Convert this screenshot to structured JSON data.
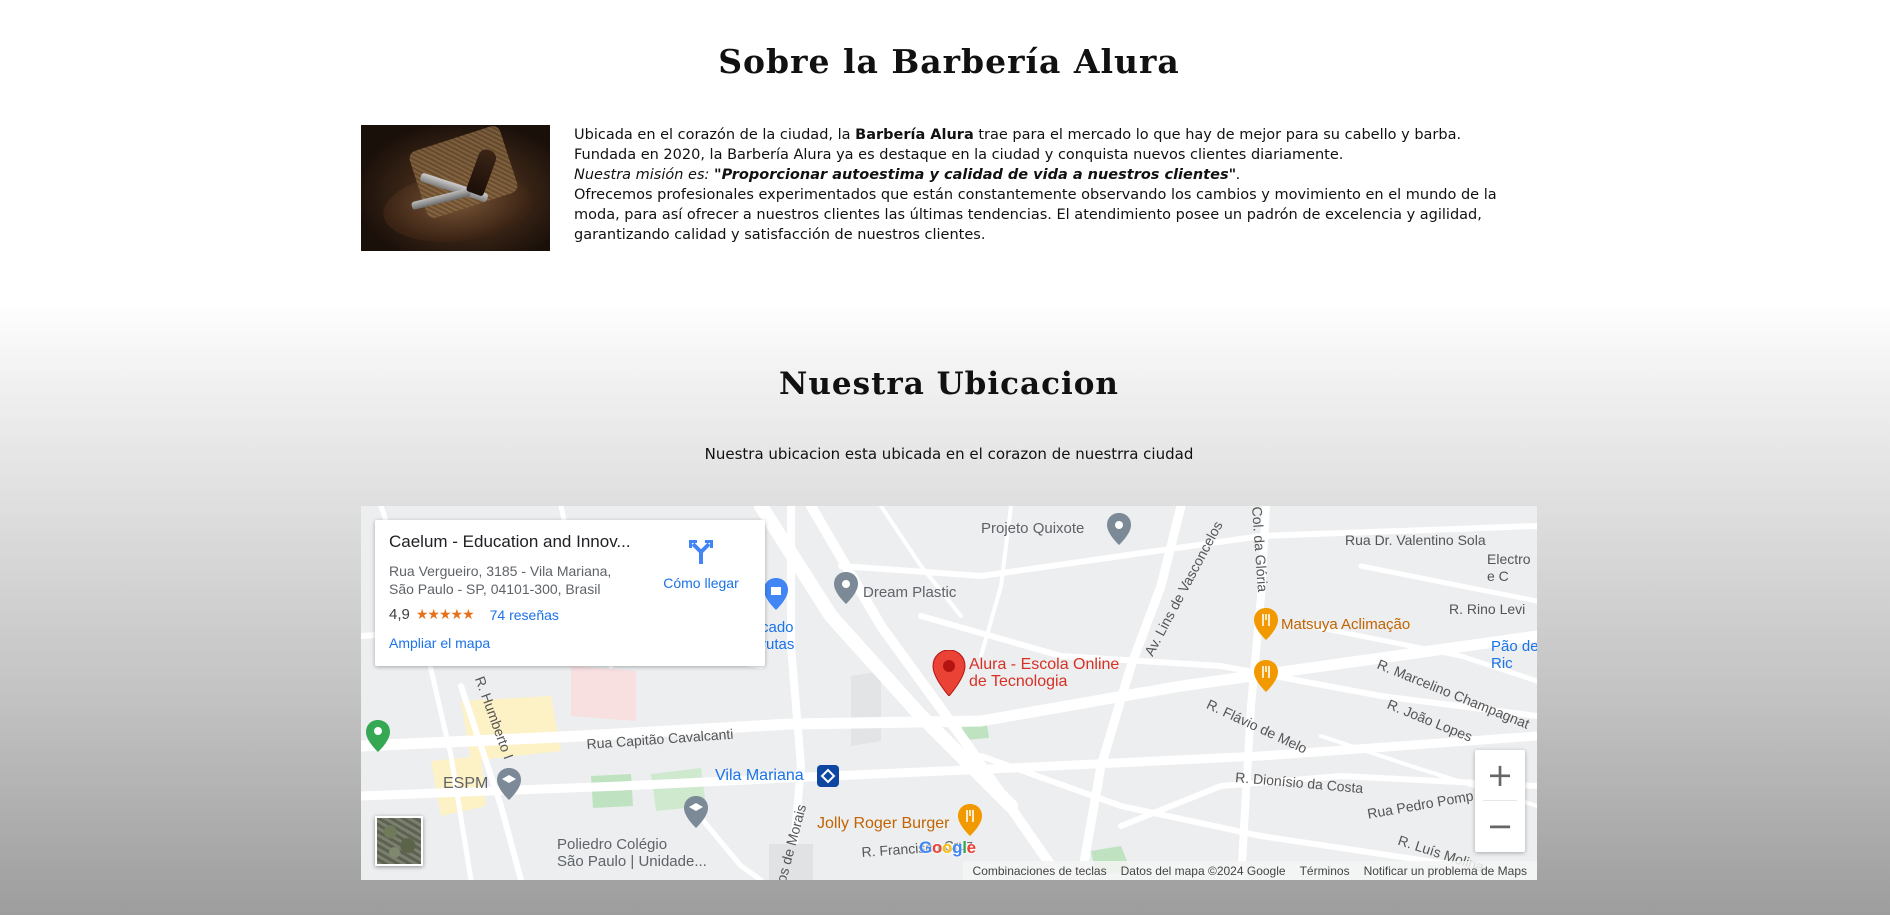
{
  "about": {
    "title": "Sobre la Barbería Alura",
    "p1_pre": "Ubicada en el corazón de la ciudad, la ",
    "p1_brand": "Barbería Alura",
    "p1_post": " trae para el mercado lo que hay de mejor para su cabello y barba.",
    "p2": "Fundada en 2020, la Barbería Alura ya es destaque en la ciudad y conquista nuevos clientes diariamente.",
    "mission_pre": "Nuestra misión es: ",
    "mission_quote": "\"Proporcionar autoestima y calidad de vida a nuestros clientes\"",
    "mission_end": ".",
    "p4": "Ofrecemos profesionales experimentados que están constantemente observando los cambios y movimiento en el mundo de la moda, para así ofrecer a nuestros clientes las últimas tendencias. El atendimiento posee un padrón de excelencia y agilidad, garantizando calidad y satisfacción de nuestros clientes."
  },
  "location": {
    "title": "Nuestra Ubicacion",
    "subtitle": "Nuestra ubicacion esta ubicada en el corazon de nuestrra ciudad"
  },
  "map": {
    "card": {
      "title": "Caelum - Education and Innov...",
      "address_line1": "Rua Vergueiro, 3185 - Vila Mariana,",
      "address_line2": "São Paulo - SP, 04101-300, Brasil",
      "rating": "4,9",
      "stars": "★★★★★",
      "reviews": "74 reseñas",
      "enlarge": "Ampliar el mapa",
      "directions": "Cómo llegar"
    },
    "labels": {
      "projeto_quixote": "Projeto Quixote",
      "dream_plastic": "Dream Plastic",
      "alura_line1": "Alura - Escola Online",
      "alura_line2": "de Tecnologia",
      "matsuya": "Matsuya Aclimação",
      "vila_mariana": "Vila Mariana",
      "espm": "ESPM",
      "jolly": "Jolly Roger Burger",
      "poliedro_line1": "Poliedro Colégio",
      "poliedro_line2": "São Paulo | Unidade...",
      "mercado_line1": "cado",
      "mercado_line2": "rutas",
      "pao_line1": "Pão de",
      "pao_line2": "Ric"
    },
    "streets": {
      "valentino": "Rua Dr. Valentino Sola",
      "electro_line1": "Electro",
      "electro_line2": "e C",
      "rino_levi": "R. Rino Levi",
      "marcelino": "R. Marcelino Champagnat",
      "joao_lopes": "R. João Lopes",
      "flavio": "R. Flávio de Melo",
      "dionisio": "R. Dionísio da Costa",
      "pedro": "Rua Pedro Pomp",
      "luis": "R. Luís Molina",
      "capitao": "Rua Capitão Cavalcanti",
      "humberto": "R. Humberto I",
      "lins": "Av. Lins de Vasconcelos",
      "gloria": "Col. da Glória",
      "francisco": "R. Francisco Cruz",
      "morais": "os de Morais"
    },
    "zoom_in": "+",
    "zoom_out": "−",
    "google": [
      "G",
      "o",
      "o",
      "g",
      "l",
      "e"
    ],
    "footer": {
      "shortcuts": "Combinaciones de teclas",
      "data": "Datos del mapa ©2024 Google",
      "terms": "Términos",
      "report": "Notificar un problema de Maps"
    },
    "colors": {
      "alura_pin": "#ea4335",
      "food_pin": "#f29900",
      "link": "#1a73e8"
    }
  }
}
